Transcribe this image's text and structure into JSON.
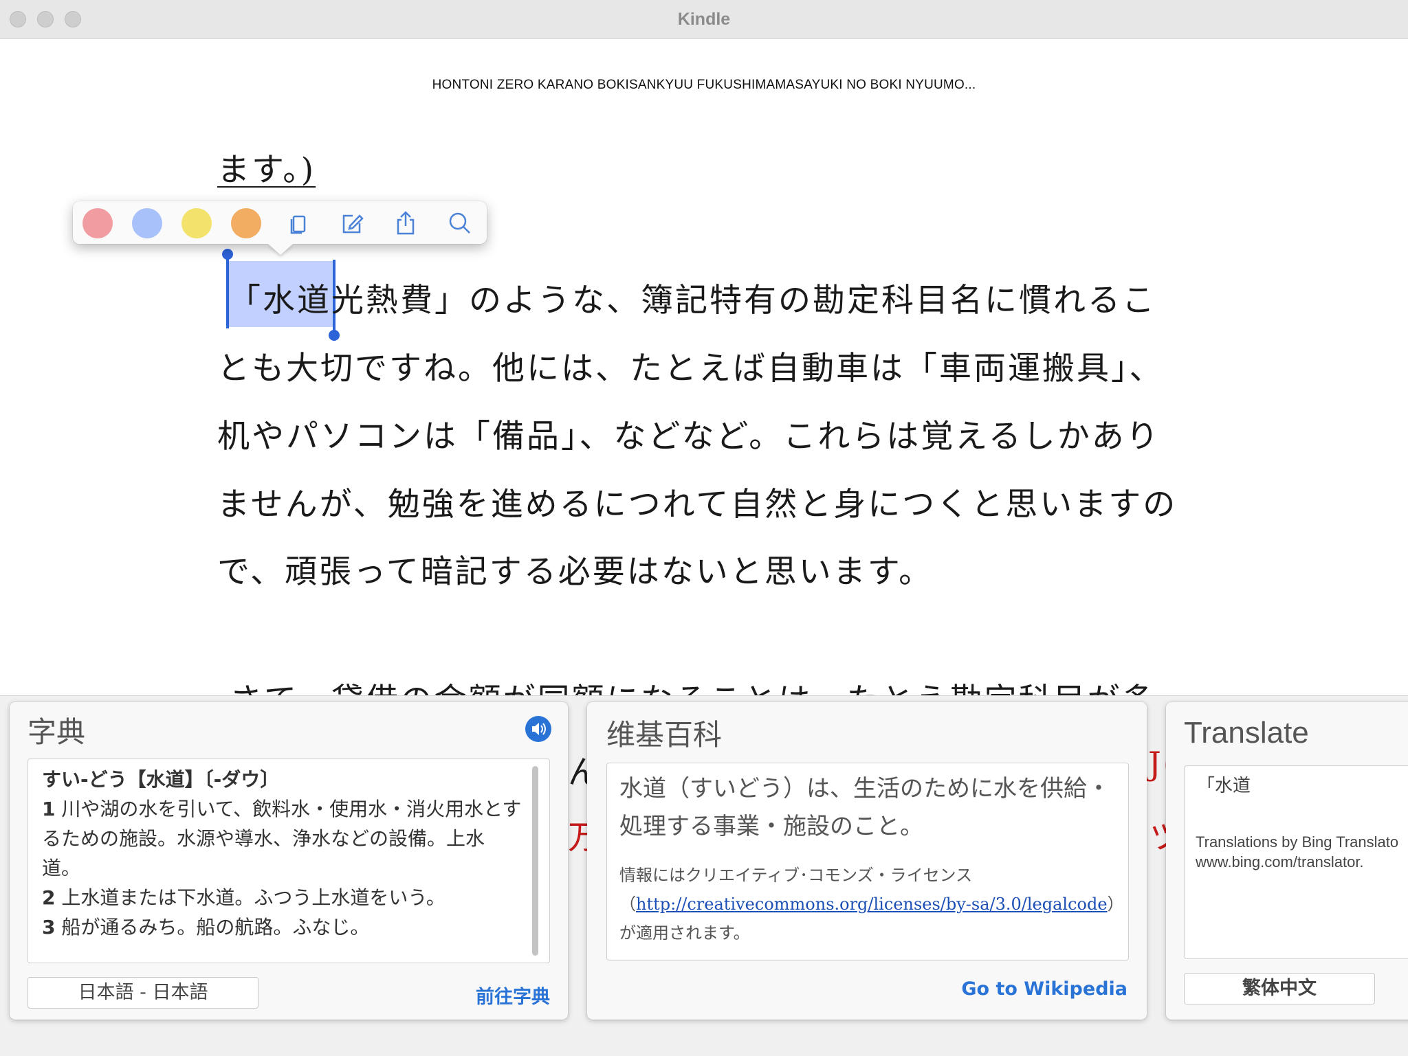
{
  "window": {
    "title": "Kindle"
  },
  "book": {
    "title": "HONTONI ZERO KARANO BOKISANKYUU FUKUSHIMAMASAYUKI NO BOKI NYUUMO..."
  },
  "reader": {
    "lines": [
      {
        "text": "ます。)",
        "underline": true
      },
      {
        "text_sel": "「水道",
        "text_rest": "光熱費」のような、簿記特有の勘定科目名に慣れるこ"
      },
      {
        "text": "とも大切ですね。他には、たとえば自動車は「車両運搬具」、"
      },
      {
        "text": "机やパソコンは「備品」、などなど。これらは覚えるしかあり"
      },
      {
        "text": "ませんが、勉強を進めるにつれて自然と身につくと思いますの"
      },
      {
        "text": "で、頑張って暗記する必要はないと思います。"
      },
      {
        "text": "さて、貸借の金額が同額になることは、たとえ勘定科目が多"
      }
    ],
    "partial_left": "ん",
    "partial_left2": "万",
    "partial_right": "J(",
    "partial_right2": "ツ",
    "selection_color": "#7896ff"
  },
  "highlight_toolbar": {
    "colors": [
      {
        "name": "pink",
        "hex": "#f19ca0"
      },
      {
        "name": "blue",
        "hex": "#a8c1fb"
      },
      {
        "name": "yellow",
        "hex": "#f3e26b"
      },
      {
        "name": "orange",
        "hex": "#f2ad62"
      }
    ],
    "tools": [
      "copy-icon",
      "note-icon",
      "share-icon",
      "search-icon"
    ]
  },
  "dictionary": {
    "title": "字典",
    "heading": "すい‐どう【水道】〔‐ダウ〕",
    "defs": [
      {
        "num": "1",
        "text": "川や湖の水を引いて、飲料水・使用水・消火用水とするための施設。水源や導水、浄水などの設備。上水道。"
      },
      {
        "num": "2",
        "text": "上水道または下水道。ふつう上水道をいう。"
      },
      {
        "num": "3",
        "text": "船が通るみち。船の航路。ふなじ。"
      }
    ],
    "language": "日本語 - 日本語",
    "go_link": "前往字典",
    "accent": "#2a73d6"
  },
  "wikipedia": {
    "title": "维基百科",
    "summary": "水道（すいどう）は、生活のために水を供給・処理する事業・施設のこと。",
    "license_pre": "情報にはクリエイティブ･コモンズ・ライセンス（",
    "license_url": "http://creativecommons.org/licenses/by-sa/3.0/legalcode",
    "license_post": "）が適用されます。",
    "go_link": "Go to Wikipedia"
  },
  "translate": {
    "title": "Translate",
    "source": "「水道",
    "note_line1": "Translations by Bing Translato",
    "note_line2": "www.bing.com/translator.",
    "language": "繁体中文"
  }
}
